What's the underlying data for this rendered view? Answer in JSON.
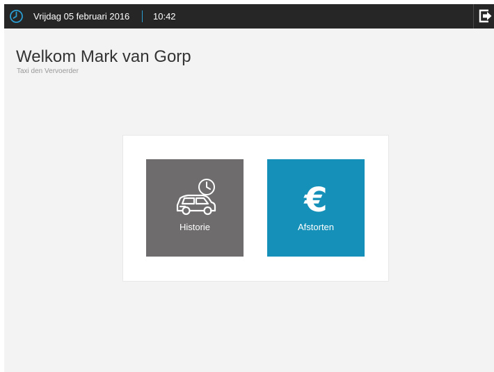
{
  "header": {
    "date": "Vrijdag 05 februari 2016",
    "time": "10:42",
    "clock_icon": "clock-icon",
    "logout_icon": "logout-icon",
    "accent_color": "#2a9ed3",
    "background_color": "#262626"
  },
  "welcome": {
    "title": "Welkom Mark van Gorp",
    "company": "Taxi den Vervoerder"
  },
  "tiles": [
    {
      "label": "Historie",
      "icon": "car-history-icon",
      "color": "#6e6c6c"
    },
    {
      "label": "Afstorten",
      "icon": "euro-icon",
      "color": "#1590b8"
    }
  ]
}
